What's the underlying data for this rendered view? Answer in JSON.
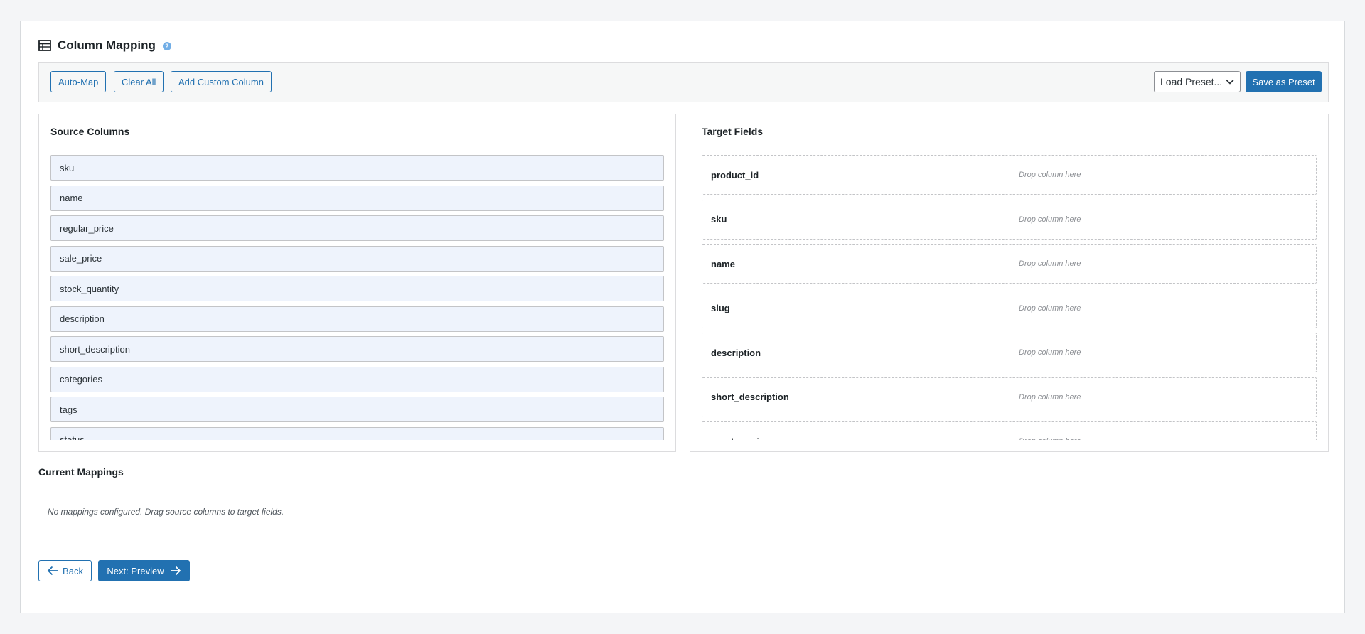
{
  "header": {
    "title": "Column Mapping",
    "help_icon": "help-icon",
    "icon": "table-icon"
  },
  "toolbar": {
    "auto_map_label": "Auto-Map",
    "clear_all_label": "Clear All",
    "add_custom_label": "Add Custom Column",
    "load_preset_value": "Load Preset...",
    "save_preset_label": "Save as Preset"
  },
  "source": {
    "title": "Source Columns",
    "items": [
      "sku",
      "name",
      "regular_price",
      "sale_price",
      "stock_quantity",
      "description",
      "short_description",
      "categories",
      "tags",
      "status"
    ]
  },
  "target": {
    "title": "Target Fields",
    "drop_placeholder": "Drop column here",
    "items": [
      "product_id",
      "sku",
      "name",
      "slug",
      "description",
      "short_description",
      "regular_price"
    ]
  },
  "mappings": {
    "title": "Current Mappings",
    "empty_text": "No mappings configured. Drag source columns to target fields."
  },
  "nav": {
    "back_label": "Back",
    "next_label": "Next: Preview"
  },
  "colors": {
    "primary": "#2271b1",
    "source_item_bg": "#eef3fc",
    "help": "#72aee6"
  }
}
